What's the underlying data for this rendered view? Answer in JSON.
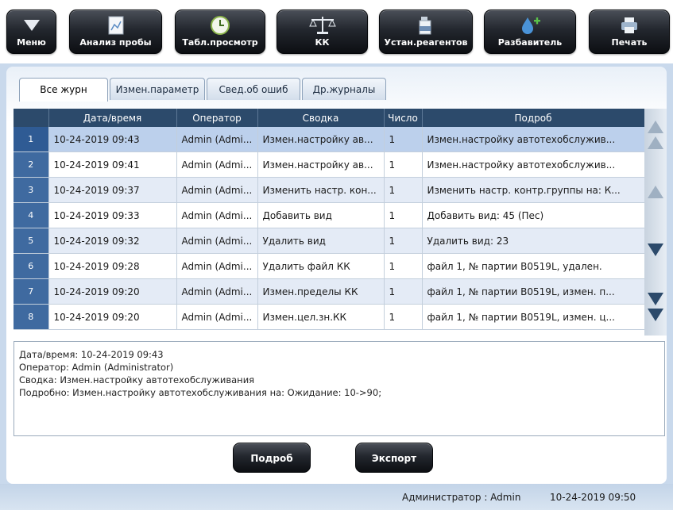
{
  "toolbar": {
    "menu": "Меню",
    "sample_analysis": "Анализ пробы",
    "table_view": "Табл.просмотр",
    "qc": "КК",
    "reagent_setup": "Устан.реагентов",
    "diluent": "Разбавитель",
    "print": "Печать"
  },
  "tabs": [
    "Все журн",
    "Измен.параметр",
    "Свед.об ошиб",
    "Др.журналы"
  ],
  "table": {
    "columns": [
      "Дата/время",
      "Оператор",
      "Сводка",
      "Число",
      "Подроб"
    ],
    "rows": [
      {
        "n": "1",
        "datetime": "10-24-2019 09:43",
        "operator": "Admin (Admi...",
        "summary": "Измен.настройку ав...",
        "count": "1",
        "details": "Измен.настройку автотехобслужив..."
      },
      {
        "n": "2",
        "datetime": "10-24-2019 09:41",
        "operator": "Admin (Admi...",
        "summary": "Измен.настройку ав...",
        "count": "1",
        "details": "Измен.настройку автотехобслужив..."
      },
      {
        "n": "3",
        "datetime": "10-24-2019 09:37",
        "operator": "Admin (Admi...",
        "summary": "Изменить настр. кон...",
        "count": "1",
        "details": "Изменить настр. контр.группы на: К..."
      },
      {
        "n": "4",
        "datetime": "10-24-2019 09:33",
        "operator": "Admin (Admi...",
        "summary": "Добавить вид",
        "count": "1",
        "details": "Добавить вид: 45 (Пес)"
      },
      {
        "n": "5",
        "datetime": "10-24-2019 09:32",
        "operator": "Admin (Admi...",
        "summary": "Удалить вид",
        "count": "1",
        "details": "Удалить вид: 23"
      },
      {
        "n": "6",
        "datetime": "10-24-2019 09:28",
        "operator": "Admin (Admi...",
        "summary": "Удалить файл КК",
        "count": "1",
        "details": "файл 1, № партии B0519L, удален."
      },
      {
        "n": "7",
        "datetime": "10-24-2019 09:20",
        "operator": "Admin (Admi...",
        "summary": "Измен.пределы КК",
        "count": "1",
        "details": "файл 1, № партии B0519L, измен. п..."
      },
      {
        "n": "8",
        "datetime": "10-24-2019 09:20",
        "operator": "Admin (Admi...",
        "summary": "Измен.цел.зн.КК",
        "count": "1",
        "details": "файл 1, № партии B0519L, измен. ц..."
      }
    ]
  },
  "details": {
    "line1": "Дата/время: 10-24-2019 09:43",
    "line2": "Оператор: Admin (Administrator)",
    "line3": "Сводка: Измен.настройку автотехобслуживания",
    "line4": "Подробно: Измен.настройку автотехобслуживания на: Ожидание: 10->90;"
  },
  "buttons": {
    "details": "Подроб",
    "export": "Экспорт"
  },
  "status": {
    "user": "Администратор : Admin",
    "time": "10-24-2019 09:50"
  },
  "colors": {
    "header": "#2c4a6b",
    "row_number": "#3f6aa0",
    "selected_row": "#bcd0ec",
    "background": "#c9d9ec"
  }
}
